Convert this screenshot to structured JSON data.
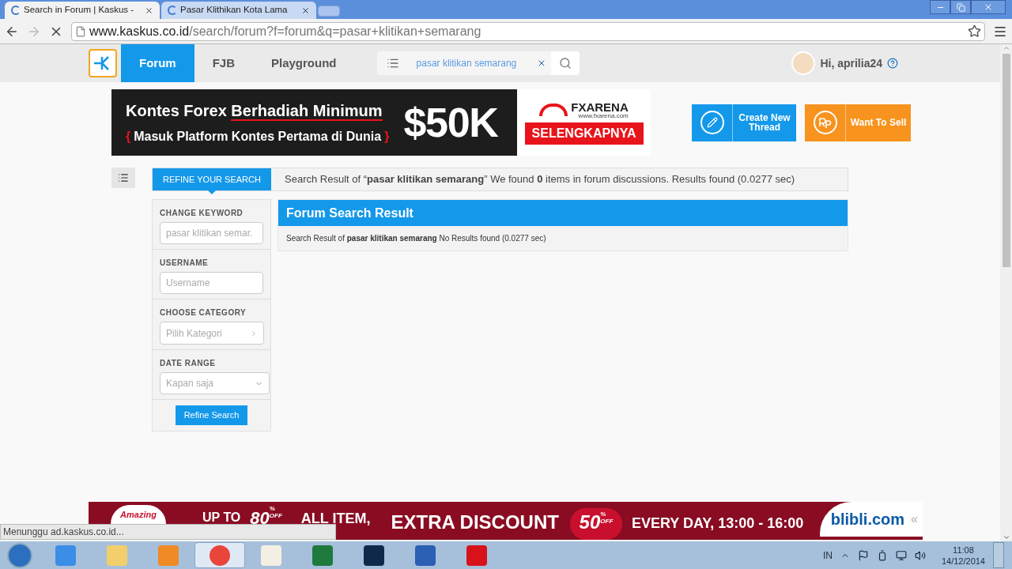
{
  "browser": {
    "tabs": [
      {
        "title": "Search in Forum | Kaskus -",
        "selected": true
      },
      {
        "title": "Pasar Klithikan Kota Lama",
        "selected": false
      }
    ],
    "url_host": "www.kaskus.co.id",
    "url_path": "/search/forum?f=forum&q=pasar+klitikan+semarang"
  },
  "nav": {
    "items": [
      {
        "label": "Forum",
        "selected": true
      },
      {
        "label": "FJB",
        "selected": false
      },
      {
        "label": "Playground",
        "selected": false
      }
    ],
    "search_value": "pasar klitikan semarang",
    "user": "Hi, aprilia24"
  },
  "ad": {
    "headline_plain": "Kontes Forex ",
    "headline_underlined": "Berhadiah Minimum",
    "subline": "Masuk Platform Kontes Pertama di Dunia",
    "brace_open": "{",
    "brace_close": "}",
    "amount": "$50K",
    "brand": "FXARENA",
    "brand_url": "www.fxarena.com",
    "cta": "SELENGKAPNYA"
  },
  "actions": [
    {
      "label": "Create New Thread",
      "kind": "thread"
    },
    {
      "label": "Want To Sell",
      "kind": "sell"
    }
  ],
  "refine": {
    "tab": "REFINE YOUR SEARCH",
    "summary": "Search Result of “**pasar klitikan semarang**” We found **0** items in forum discussions. Results found (0.0277 sec)",
    "fields": [
      {
        "label": "CHANGE KEYWORD",
        "kind": "text",
        "placeholder": "pasar klitikan semar."
      },
      {
        "label": "USERNAME",
        "kind": "text",
        "placeholder": "Username"
      },
      {
        "label": "CHOOSE CATEGORY",
        "kind": "picker",
        "placeholder": "Pilih Kategori"
      },
      {
        "label": "DATE RANGE",
        "kind": "dropdown",
        "placeholder": "Kapan saja"
      }
    ],
    "button": "Refine Search"
  },
  "result": {
    "title": "Forum Search Result",
    "text": "Search Result of **pasar klitikan semarang** No Results found (0.0277 sec)"
  },
  "bottom_ad": {
    "badge": "Amazing",
    "up_to": "UP TO",
    "pct1": "80",
    "off": "% OFF",
    "all": "ALL ITEM,",
    "extra": "EXTRA DISCOUNT",
    "pct2": "50",
    "off2": "% OFF",
    "every": "EVERY DAY, 13:00 - 16:00",
    "brand": "blibli.com",
    "collapse": "«"
  },
  "status": "Menunggu ad.kaskus.co.id...",
  "taskbar": {
    "lang": "IN",
    "time": "11:08",
    "date": "14/12/2014"
  }
}
